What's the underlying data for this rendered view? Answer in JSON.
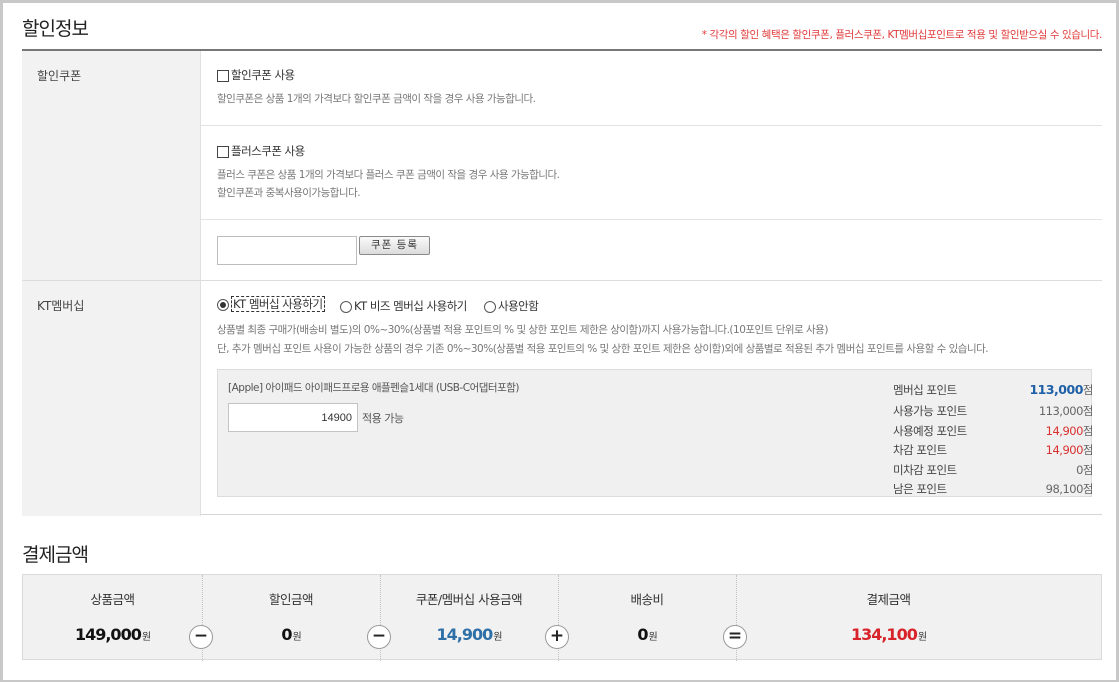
{
  "discount": {
    "title": "할인정보",
    "note": "* 각각의 할인 혜택은 할인쿠폰, 플러스쿠폰, KT멤버십포인트로 적용 및 할인받으실 수 있습니다."
  },
  "coupon": {
    "label": "할인쿠폰",
    "discount_coupon": {
      "checkbox_label": "할인쿠폰 사용",
      "desc": "할인쿠폰은 상품 1개의 가격보다 할인쿠폰 금액이 작을 경우 사용 가능합니다."
    },
    "plus_coupon": {
      "checkbox_label": "플러스쿠폰 사용",
      "desc1": "플러스 쿠폰은 상품 1개의 가격보다 플러스 쿠폰 금액이 작을 경우 사용 가능합니다.",
      "desc2": "할인쿠폰과 중복사용이가능합니다."
    },
    "code_input_value": "",
    "register_button": "쿠폰 등록"
  },
  "kt": {
    "label": "KT멤버십",
    "options": [
      "KT 멤버십 사용하기",
      "KT 비즈 멤버십 사용하기",
      "사용안함"
    ],
    "selected": 0,
    "desc1": "상품별 최종 구매가(배송비 별도)의 0%~30%(상품별 적용 포인트의 % 및 상한 포인트 제한은 상이함)까지 사용가능합니다.(10포인트 단위로 사용)",
    "desc2": "단, 추가 멤버십 포인트 사용이 가능한 상품의 경우 기존 0%~30%(상품별 적용 포인트의 % 및 상한 포인트 제한은 상이함)외에 상품별로 적용된 추가 멤버십 포인트를 사용할 수 있습니다.",
    "product_name": "[Apple] 아이패드 아이패드프로용 애플펜슬1세대 (USB-C어댑터포함)",
    "point_input": "14900",
    "available_label": "적용 가능",
    "points": [
      {
        "label": "멤버십 포인트",
        "value": "113,000",
        "unit": "점",
        "color": "#1f5fa6"
      },
      {
        "label": "사용가능 포인트",
        "value": "113,000",
        "unit": "점",
        "color": "#666666"
      },
      {
        "label": "사용예정 포인트",
        "value": "14,900",
        "unit": "점",
        "color": "#d93030"
      },
      {
        "label": "차감 포인트",
        "value": "14,900",
        "unit": "점",
        "color": "#d93030"
      },
      {
        "label": "미차감 포인트",
        "value": "0",
        "unit": "점",
        "color": "#666666"
      },
      {
        "label": "남은 포인트",
        "value": "98,100",
        "unit": "점",
        "color": "#666666"
      }
    ]
  },
  "payment": {
    "title": "결제금액",
    "columns": [
      {
        "label": "상품금액",
        "value": "149,000",
        "unit": "원",
        "color": "#111111"
      },
      {
        "label": "할인금액",
        "value": "0",
        "unit": "원",
        "color": "#111111"
      },
      {
        "label": "쿠폰/멤버십 사용금액",
        "value": "14,900",
        "unit": "원",
        "color": "#2e6fa7"
      },
      {
        "label": "배송비",
        "value": "0",
        "unit": "원",
        "color": "#111111"
      },
      {
        "label": "결제금액",
        "value": "134,100",
        "unit": "원",
        "color": "#d8232a"
      }
    ],
    "operators": [
      "−",
      "−",
      "+",
      "="
    ]
  }
}
